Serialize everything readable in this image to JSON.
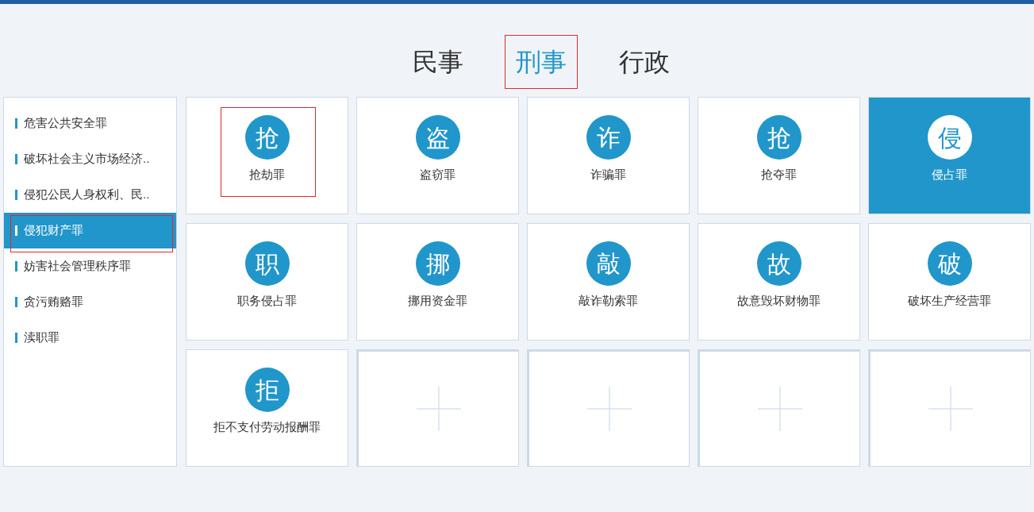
{
  "tabs": [
    {
      "label": "民事",
      "selected": false,
      "annotated": false
    },
    {
      "label": "刑事",
      "selected": true,
      "annotated": true
    },
    {
      "label": "行政",
      "selected": false,
      "annotated": false
    }
  ],
  "sidebar": {
    "items": [
      {
        "label": "危害公共安全罪",
        "selected": false,
        "annotated": false
      },
      {
        "label": "破坏社会主义市场经济..",
        "selected": false,
        "annotated": false
      },
      {
        "label": "侵犯公民人身权利、民..",
        "selected": false,
        "annotated": false
      },
      {
        "label": "侵犯财产罪",
        "selected": true,
        "annotated": true
      },
      {
        "label": "妨害社会管理秩序罪",
        "selected": false,
        "annotated": false
      },
      {
        "label": "贪污贿赂罪",
        "selected": false,
        "annotated": false
      },
      {
        "label": "渎职罪",
        "selected": false,
        "annotated": false
      }
    ]
  },
  "tiles": [
    {
      "kind": "crime",
      "badge": "抢",
      "label": "抢劫罪",
      "selected": false,
      "annotated": true
    },
    {
      "kind": "crime",
      "badge": "盗",
      "label": "盗窃罪",
      "selected": false,
      "annotated": false
    },
    {
      "kind": "crime",
      "badge": "诈",
      "label": "诈骗罪",
      "selected": false,
      "annotated": false
    },
    {
      "kind": "crime",
      "badge": "抢",
      "label": "抢夺罪",
      "selected": false,
      "annotated": false
    },
    {
      "kind": "crime",
      "badge": "侵",
      "label": "侵占罪",
      "selected": true,
      "annotated": false
    },
    {
      "kind": "crime",
      "badge": "职",
      "label": "职务侵占罪",
      "selected": false,
      "annotated": false
    },
    {
      "kind": "crime",
      "badge": "挪",
      "label": "挪用资金罪",
      "selected": false,
      "annotated": false
    },
    {
      "kind": "crime",
      "badge": "敲",
      "label": "敲诈勒索罪",
      "selected": false,
      "annotated": false
    },
    {
      "kind": "crime",
      "badge": "故",
      "label": "故意毁坏财物罪",
      "selected": false,
      "annotated": false
    },
    {
      "kind": "crime",
      "badge": "破",
      "label": "破坏生产经营罪",
      "selected": false,
      "annotated": false
    },
    {
      "kind": "crime",
      "badge": "拒",
      "label": "拒不支付劳动报酬罪",
      "selected": false,
      "annotated": false
    },
    {
      "kind": "add"
    },
    {
      "kind": "add"
    },
    {
      "kind": "add"
    },
    {
      "kind": "add"
    }
  ]
}
